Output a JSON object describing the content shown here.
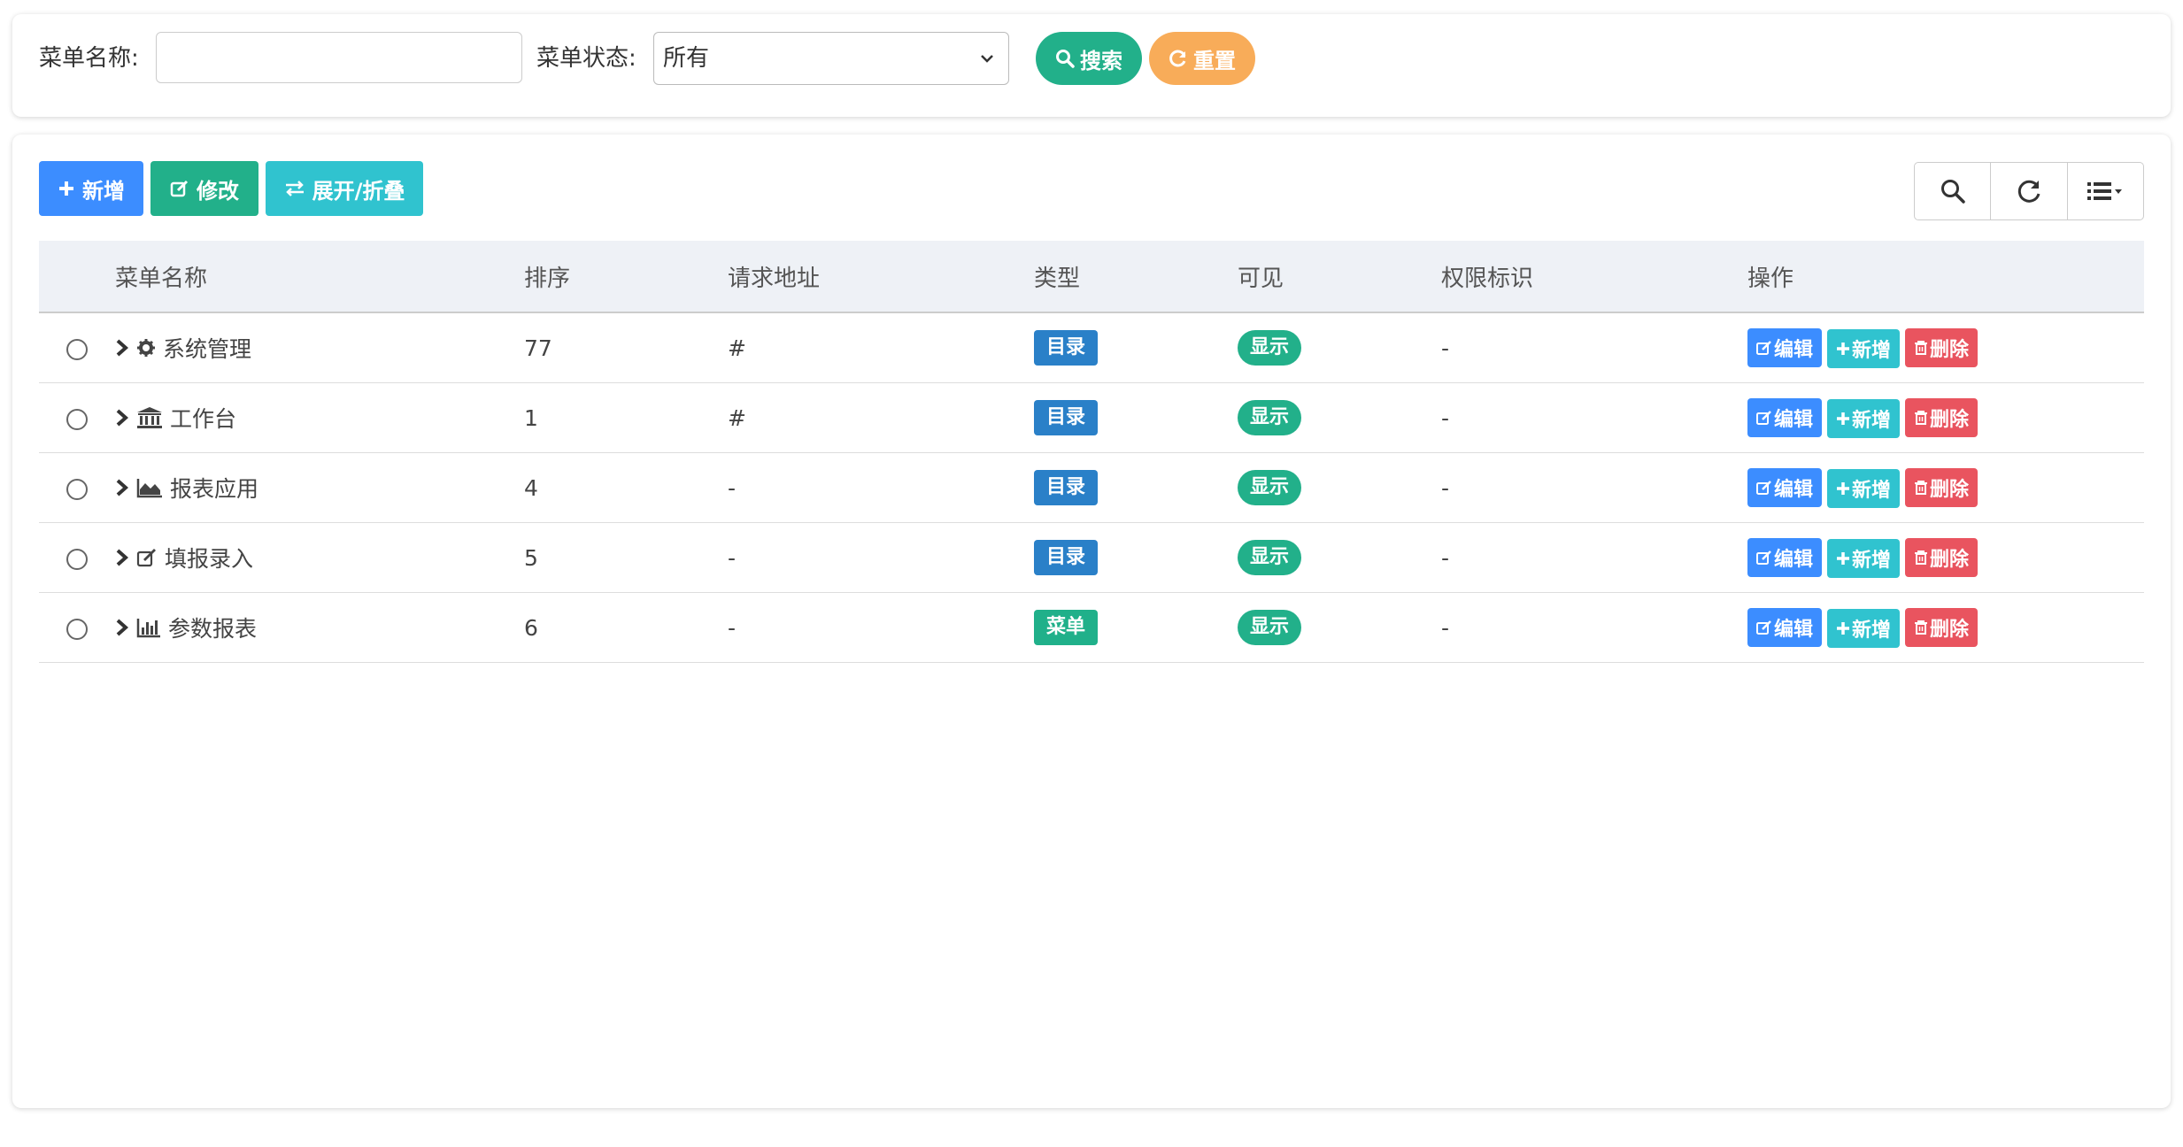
{
  "search": {
    "menu_name_label": "菜单名称:",
    "menu_name_value": "",
    "menu_status_label": "菜单状态:",
    "menu_status_selected": "所有",
    "search_button": "搜索",
    "reset_button": "重置"
  },
  "toolbar": {
    "add_label": "新增",
    "edit_label": "修改",
    "expand_label": "展开/折叠"
  },
  "table": {
    "headers": [
      "菜单名称",
      "排序",
      "请求地址",
      "类型",
      "可见",
      "权限标识",
      "操作"
    ],
    "rows": [
      {
        "name": "系统管理",
        "icon": "gear-icon",
        "order": "77",
        "url": "#",
        "type": "目录",
        "visible": "显示",
        "perm": "-"
      },
      {
        "name": "工作台",
        "icon": "bank-icon",
        "order": "1",
        "url": "#",
        "type": "目录",
        "visible": "显示",
        "perm": "-"
      },
      {
        "name": "报表应用",
        "icon": "area-chart-icon",
        "order": "4",
        "url": "-",
        "type": "目录",
        "visible": "显示",
        "perm": "-"
      },
      {
        "name": "填报录入",
        "icon": "edit-icon",
        "order": "5",
        "url": "-",
        "type": "目录",
        "visible": "显示",
        "perm": "-"
      },
      {
        "name": "参数报表",
        "icon": "bar-chart-icon",
        "order": "6",
        "url": "-",
        "type": "菜单",
        "visible": "显示",
        "perm": "-"
      }
    ],
    "actions": {
      "edit": "编辑",
      "add": "新增",
      "delete": "删除"
    }
  },
  "colors": {
    "primary": "#3c8dff",
    "success": "#22b08a",
    "info": "#30c3cf",
    "warning": "#f8ac59",
    "danger": "#e9545f",
    "dir_tag": "#2a80c8",
    "menu_tag": "#20b08a"
  }
}
